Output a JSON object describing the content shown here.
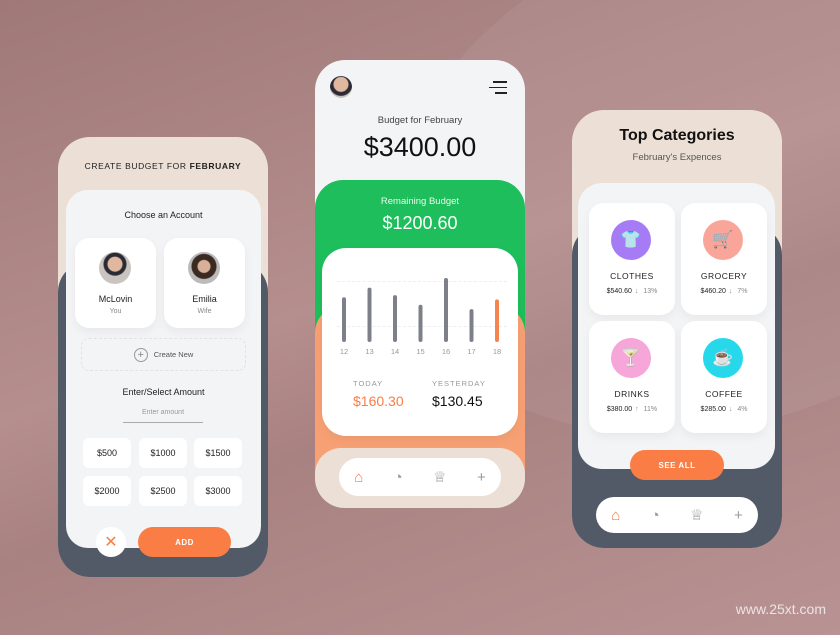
{
  "left": {
    "title_prefix": "CREATE BUDGET FOR ",
    "title_month": "FEBRUARY",
    "choose_label": "Choose an Account",
    "accounts": [
      {
        "name": "McLovin",
        "role": "You"
      },
      {
        "name": "Emilia",
        "role": "Wife"
      }
    ],
    "create_new": "Create New",
    "amount_label": "Enter/Select Amount",
    "amount_placeholder": "Enter amount",
    "amounts": [
      "$500",
      "$1000",
      "$1500",
      "$2000",
      "$2500",
      "$3000"
    ],
    "add_label": "ADD"
  },
  "middle": {
    "budget_label": "Budget for February",
    "budget_value": "$3400.00",
    "remaining_label": "Remaining Budget",
    "remaining_value": "$1200.60",
    "today_label": "TODAY",
    "today_value": "$160.30",
    "yesterday_label": "YESTERDAY",
    "yesterday_value": "$130.45"
  },
  "chart_data": {
    "type": "bar",
    "categories": [
      "12",
      "13",
      "14",
      "15",
      "16",
      "17",
      "18"
    ],
    "values": [
      38,
      47,
      40,
      31,
      56,
      27,
      36
    ],
    "highlight": "18",
    "colors": {
      "bar": "#7d8089",
      "highlight": "#f6844f"
    }
  },
  "right": {
    "title": "Top Categories",
    "subtitle": "February's Expences",
    "categories": [
      {
        "name": "CLOTHES",
        "amount": "$540.60",
        "change": "13%",
        "trend": "down",
        "icon": "shirt-icon",
        "color": "#a57cf5"
      },
      {
        "name": "GROCERY",
        "amount": "$460.20",
        "change": "7%",
        "trend": "down",
        "icon": "cart-icon",
        "color": "#f9a59a"
      },
      {
        "name": "DRINKS",
        "amount": "$380.00",
        "change": "11%",
        "trend": "up",
        "icon": "cocktail-icon",
        "color": "#f6a6d9"
      },
      {
        "name": "COFFEE",
        "amount": "$285.00",
        "change": "4%",
        "trend": "down",
        "icon": "coffee-icon",
        "color": "#27d7ea"
      }
    ],
    "see_all": "SEE ALL"
  },
  "colors": {
    "accent": "#fa7d45",
    "green": "#1fbe5c",
    "dark": "#535a67"
  },
  "watermark": "www.25xt.com"
}
